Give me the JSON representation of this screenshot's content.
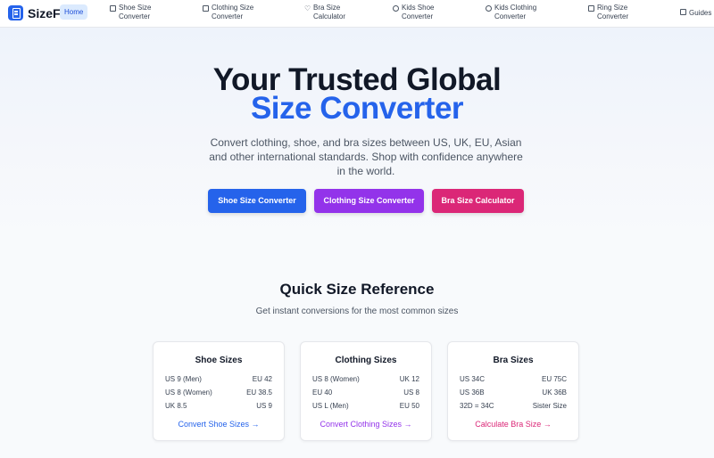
{
  "nav": {
    "logo": "SizeFit",
    "home": "Home",
    "items": [
      {
        "line1": "Shoe Size",
        "line2": "Converter",
        "icon": "ruler-icon"
      },
      {
        "line1": "Clothing Size",
        "line2": "Converter",
        "icon": "shirt-icon"
      },
      {
        "line1": "Bra Size",
        "line2": "Calculator",
        "icon": "heart-icon"
      },
      {
        "line1": "Kids Shoe",
        "line2": "Converter",
        "icon": "baby-icon"
      },
      {
        "line1": "Kids Clothing",
        "line2": "Converter",
        "icon": "baby-icon"
      },
      {
        "line1": "Ring Size",
        "line2": "Converter",
        "icon": "ruler-icon"
      },
      {
        "line1": "Guides",
        "line2": "",
        "icon": "book-icon"
      }
    ]
  },
  "hero": {
    "title_line1": "Your Trusted Global",
    "title_line2": "Size Converter",
    "subtitle": "Convert clothing, shoe, and bra sizes between US, UK, EU, Asian and other international standards. Shop with confidence anywhere in the world.",
    "buttons": [
      "Shoe Size Converter",
      "Clothing Size Converter",
      "Bra Size Calculator"
    ]
  },
  "quick_reference": {
    "title": "Quick Size Reference",
    "subtitle": "Get instant conversions for the most common sizes",
    "cards": [
      {
        "title": "Shoe Sizes",
        "rows": [
          [
            "US 9 (Men)",
            "EU 42"
          ],
          [
            "US 8 (Women)",
            "EU 38.5"
          ],
          [
            "UK 8.5",
            "US 9"
          ]
        ],
        "link": "Convert Shoe Sizes →",
        "color": "#2563eb"
      },
      {
        "title": "Clothing Sizes",
        "rows": [
          [
            "US 8 (Women)",
            "UK 12"
          ],
          [
            "EU 40",
            "US 8"
          ],
          [
            "US L (Men)",
            "EU 50"
          ]
        ],
        "link": "Convert Clothing Sizes →",
        "color": "#9333ea"
      },
      {
        "title": "Bra Sizes",
        "rows": [
          [
            "US 34C",
            "EU 75C"
          ],
          [
            "US 36B",
            "UK 36B"
          ],
          [
            "32D = 34C",
            "Sister Size"
          ]
        ],
        "link": "Calculate Bra Size →",
        "color": "#db2777"
      }
    ]
  },
  "colors": {
    "primary": "#2563eb",
    "purple": "#9333ea",
    "pink": "#db2777"
  }
}
